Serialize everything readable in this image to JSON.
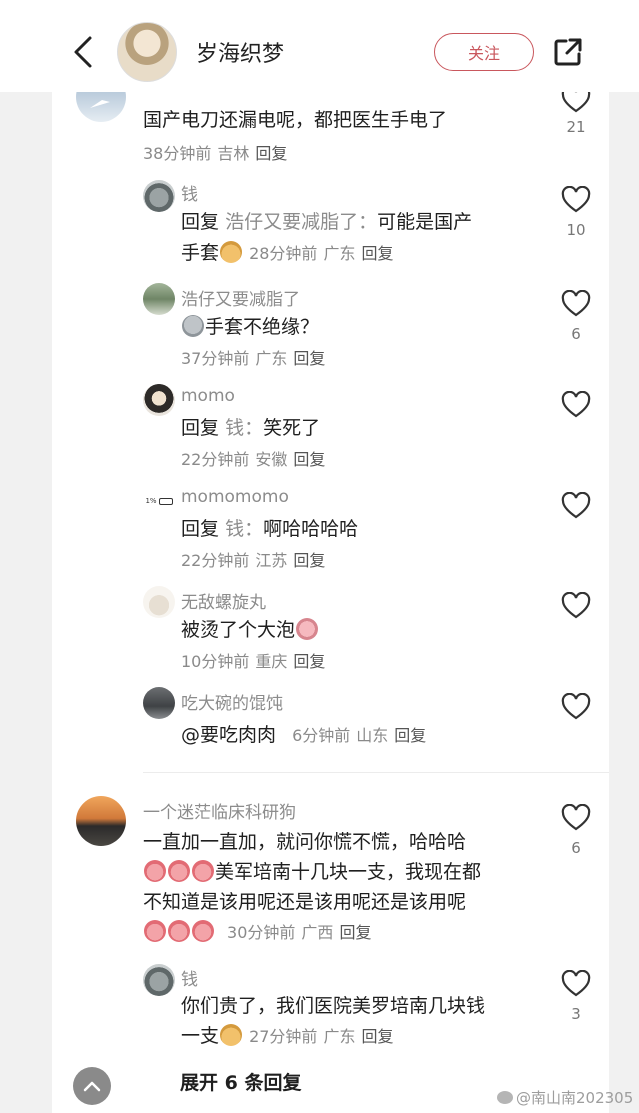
{
  "header": {
    "user_name": "岁海织梦",
    "follow_label": "关注"
  },
  "comments": [
    {
      "name": "",
      "text": "国产电刀还漏电呢，都把医生手电了",
      "time": "38分钟前",
      "region": "吉林",
      "reply": "回复",
      "likes": "21"
    },
    {
      "name": "钱",
      "reply_prefix": "回复",
      "reply_target": "浩仔又要减脂了：",
      "text_line1": "可能是国产",
      "text_line2": "手套",
      "time": "28分钟前",
      "region": "广东",
      "reply": "回复",
      "likes": "10"
    },
    {
      "name": "浩仔又要减脂了",
      "text": "手套不绝缘？",
      "time": "37分钟前",
      "region": "广东",
      "reply": "回复",
      "likes": "6"
    },
    {
      "name": "momo",
      "reply_prefix": "回复",
      "reply_target": "钱：",
      "text": "笑死了",
      "time": "22分钟前",
      "region": "安徽",
      "reply": "回复",
      "likes": ""
    },
    {
      "name": "momomomo",
      "avatar_text": "1%",
      "reply_prefix": "回复",
      "reply_target": "钱：",
      "text": "啊哈哈哈哈",
      "time": "22分钟前",
      "region": "江苏",
      "reply": "回复",
      "likes": ""
    },
    {
      "name": "无敌螺旋丸",
      "text": "被烫了个大泡",
      "time": "10分钟前",
      "region": "重庆",
      "reply": "回复",
      "likes": ""
    },
    {
      "name": "吃大碗的馄饨",
      "text": "@要吃肉肉",
      "time": "6分钟前",
      "region": "山东",
      "reply": "回复",
      "likes": ""
    },
    {
      "name": "一个迷茫临床科研狗",
      "line1": "一直加一直加，就问你慌不慌，哈哈哈",
      "line2": "美军培南十几块一支，我现在都",
      "line3": "不知道是该用呢还是该用呢还是该用呢",
      "time": "30分钟前",
      "region": "广西",
      "reply": "回复",
      "likes": "6"
    },
    {
      "name": "钱",
      "line1": "你们贵了，我们医院美罗培南几块钱",
      "line2": "一支",
      "time": "27分钟前",
      "region": "广东",
      "reply": "回复",
      "likes": "3"
    }
  ],
  "expand_label": "展开 6 条回复",
  "watermark": "@南山南202305",
  "icons": {
    "back": "chevron-left-icon",
    "share": "share-icon",
    "like": "heart-outline-icon",
    "scroll_top": "arrow-up-icon"
  },
  "colors": {
    "follow": "#c9575d",
    "meta": "#8a8a8a",
    "text": "#1f1f1f"
  }
}
